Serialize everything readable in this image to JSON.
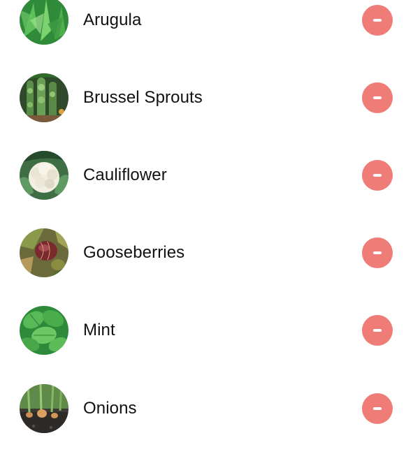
{
  "colors": {
    "remove_button": "#f07c78",
    "text": "#111111",
    "background": "#ffffff"
  },
  "items": [
    {
      "label": "Arugula",
      "image_icon": "arugula-thumbnail"
    },
    {
      "label": "Brussel Sprouts",
      "image_icon": "brussel-sprouts-thumbnail"
    },
    {
      "label": "Cauliflower",
      "image_icon": "cauliflower-thumbnail"
    },
    {
      "label": "Gooseberries",
      "image_icon": "gooseberries-thumbnail"
    },
    {
      "label": "Mint",
      "image_icon": "mint-thumbnail"
    },
    {
      "label": "Onions",
      "image_icon": "onions-thumbnail"
    }
  ],
  "remove_icon": "minus-circle-icon"
}
